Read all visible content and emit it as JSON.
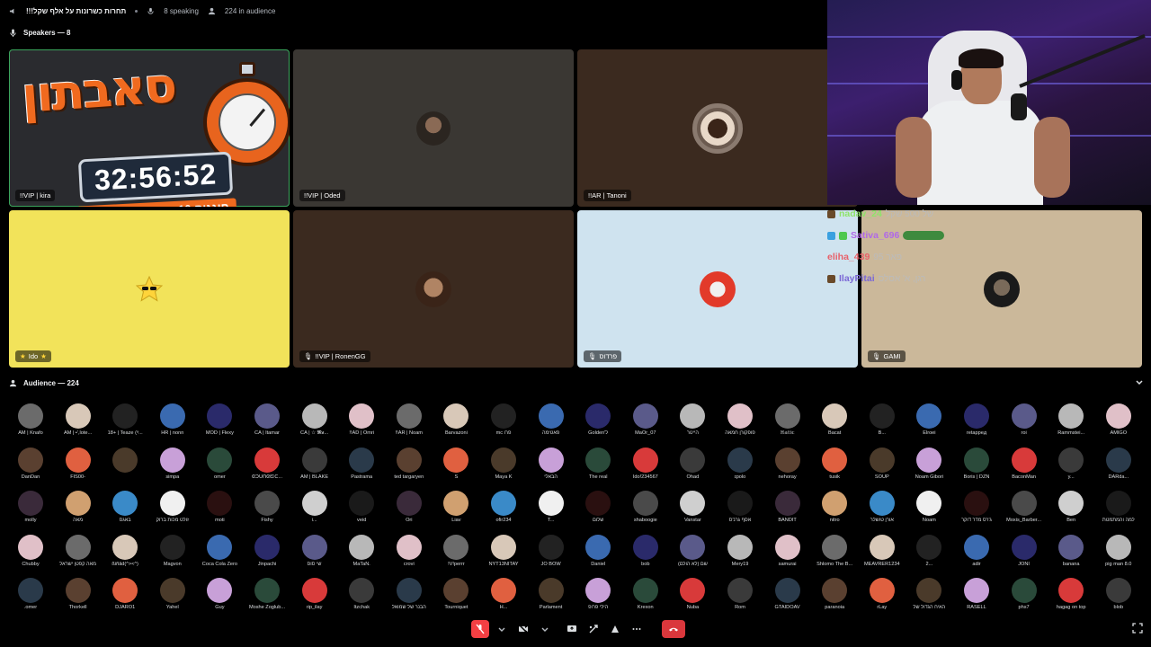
{
  "topbar": {
    "title": "!!!תחרות כשרונות על אלף שקל",
    "speaking": "8 speaking",
    "audience_count": "224 in audience"
  },
  "speakers": {
    "header": "Speakers — 8",
    "tiles": [
      {
        "label": "!!VIP | kira",
        "bg": "#2f3136",
        "banner": true
      },
      {
        "label": "!!VIP | Oded",
        "bg": "#3a3733"
      },
      {
        "label": "!!AR | Tanoni",
        "bg": "#3b2a1f"
      },
      {
        "label": "Ido",
        "bg": "#f2e35a",
        "star_badge": true
      },
      {
        "label": "!!VIP | RonenGG",
        "bg": "#3b2a1f",
        "muted": true
      },
      {
        "label": "פרדוס",
        "bg": "#cfe3ef",
        "muted": true
      },
      {
        "label": "GAMI",
        "bg": "#cbb89a",
        "muted": true
      }
    ]
  },
  "banner": {
    "title": "סאבתון",
    "timer": "32:56:52",
    "subtitle": "חוגגים 10 שנים של שידורים"
  },
  "chat": [
    {
      "user": "nadav_24",
      "msg": "של 500 שקל",
      "color": "#8fe36a"
    },
    {
      "user": "Sativa_696",
      "msg": "",
      "color": "#b068e8"
    },
    {
      "user": "eliha_439",
      "msg": "פאר 95",
      "color": "#e8616a"
    },
    {
      "user": "IlayPitai",
      "msg": "רגן, א' אסלס",
      "color": "#7b68d6"
    }
  ],
  "audience": {
    "header": "Audience — 224",
    "rows": [
      [
        "AM | Knafo",
        "AM | •',lote...",
        "18+ | Teaze (ᵃ...",
        "HR | nonn",
        "MOD | Flexy",
        "CA | Itamar",
        "CA | ☆ 𝕸𝖆...",
        "!!AD | Omri",
        "!!AR | Noam",
        "Barvazoni",
        "mc פרו",
        "פאטימה",
        "Golden'ל",
        "MaOr_07",
        "הייטר",
        "פופקורן חמאה",
        "ℍ𝕒𝕥𝕚𝕔",
        "Bacat",
        "B...",
        "Elroei",
        "retappeд",
        "roi",
        "Rammstei...",
        "AMIGO"
      ],
      [
        "DanDan",
        "FIS00-",
        "",
        "simpa",
        "omer",
        "ᘓᑐᑌᑎᘓᘿᑕ...",
        "AM | BLAKE",
        "Pastrama",
        "ted targaryen",
        "S",
        "Maya K",
        "הבאלי",
        "The real",
        "Ido!234567",
        "Ohad",
        "ɪpolo",
        "nehoray",
        "tusik",
        "SOUP",
        "Noam Gibori",
        "Boris | DZN",
        "BaconMan",
        "y...",
        "DARda..."
      ],
      [
        "molly",
        "מאה",
        "באגס",
        "זולט מכות ברוק",
        "moti",
        "Fishy",
        "i...",
        "veid",
        "Ori",
        "Liav",
        "ofir234",
        "T...",
        "שלום",
        "shaboogie",
        "Vanstar",
        "אסף גרנ'ס",
        "BANDIT",
        "nitro",
        "אורן טושלר",
        "Noam",
        "ג'רס מדר דוקר",
        "Moxis_Barber...",
        "Ben",
        "למה והמתמטת"
      ],
      [
        "Chubby",
        "מאה קפטן ישראל",
        "ßiñåd(^><^)",
        "Magvon",
        "Coca Cola Zero",
        "Jinpachi",
        "שי סוס",
        "MaTaN.",
        "crovi",
        "!V!perrr",
        "NYT13NITAY",
        "JO BOW",
        "Daniel",
        "bob",
        "שם (לא הולם)",
        "Mery19",
        "samurai",
        "Shlomo The B...",
        "MEAVRER1234",
        "2...",
        "adir",
        "JONI",
        "banana",
        "pig man 8.0"
      ],
      [
        ".omer",
        "Thorkell",
        "DJARO1",
        "Yahel",
        "Guy",
        "Moshe Zoglub...",
        "rip_ilay",
        "Itzchak",
        "הבנר של שמואל",
        "Tourniquet",
        "H...",
        "Parlament",
        "הילי פרופ",
        "Krexon",
        "Nuba",
        "Rom",
        "GTAIDOAV",
        "paranoia",
        "rLay",
        "האיח הגדול של",
        "RASELL",
        "phs7",
        "hagag on top",
        "blob"
      ]
    ]
  },
  "colors": {
    "speaking_outline": "#3ba55c",
    "mic_muted": "#f23f43",
    "leave": "#da373c",
    "banner_orange": "#f06a1f"
  },
  "icons": [
    "speaker-icon",
    "audience-icon",
    "mic-off-icon",
    "camera-icon",
    "screen-share-icon",
    "activity-icon",
    "more-icon",
    "hangup-icon",
    "fullscreen-icon",
    "chevron-down-icon"
  ]
}
